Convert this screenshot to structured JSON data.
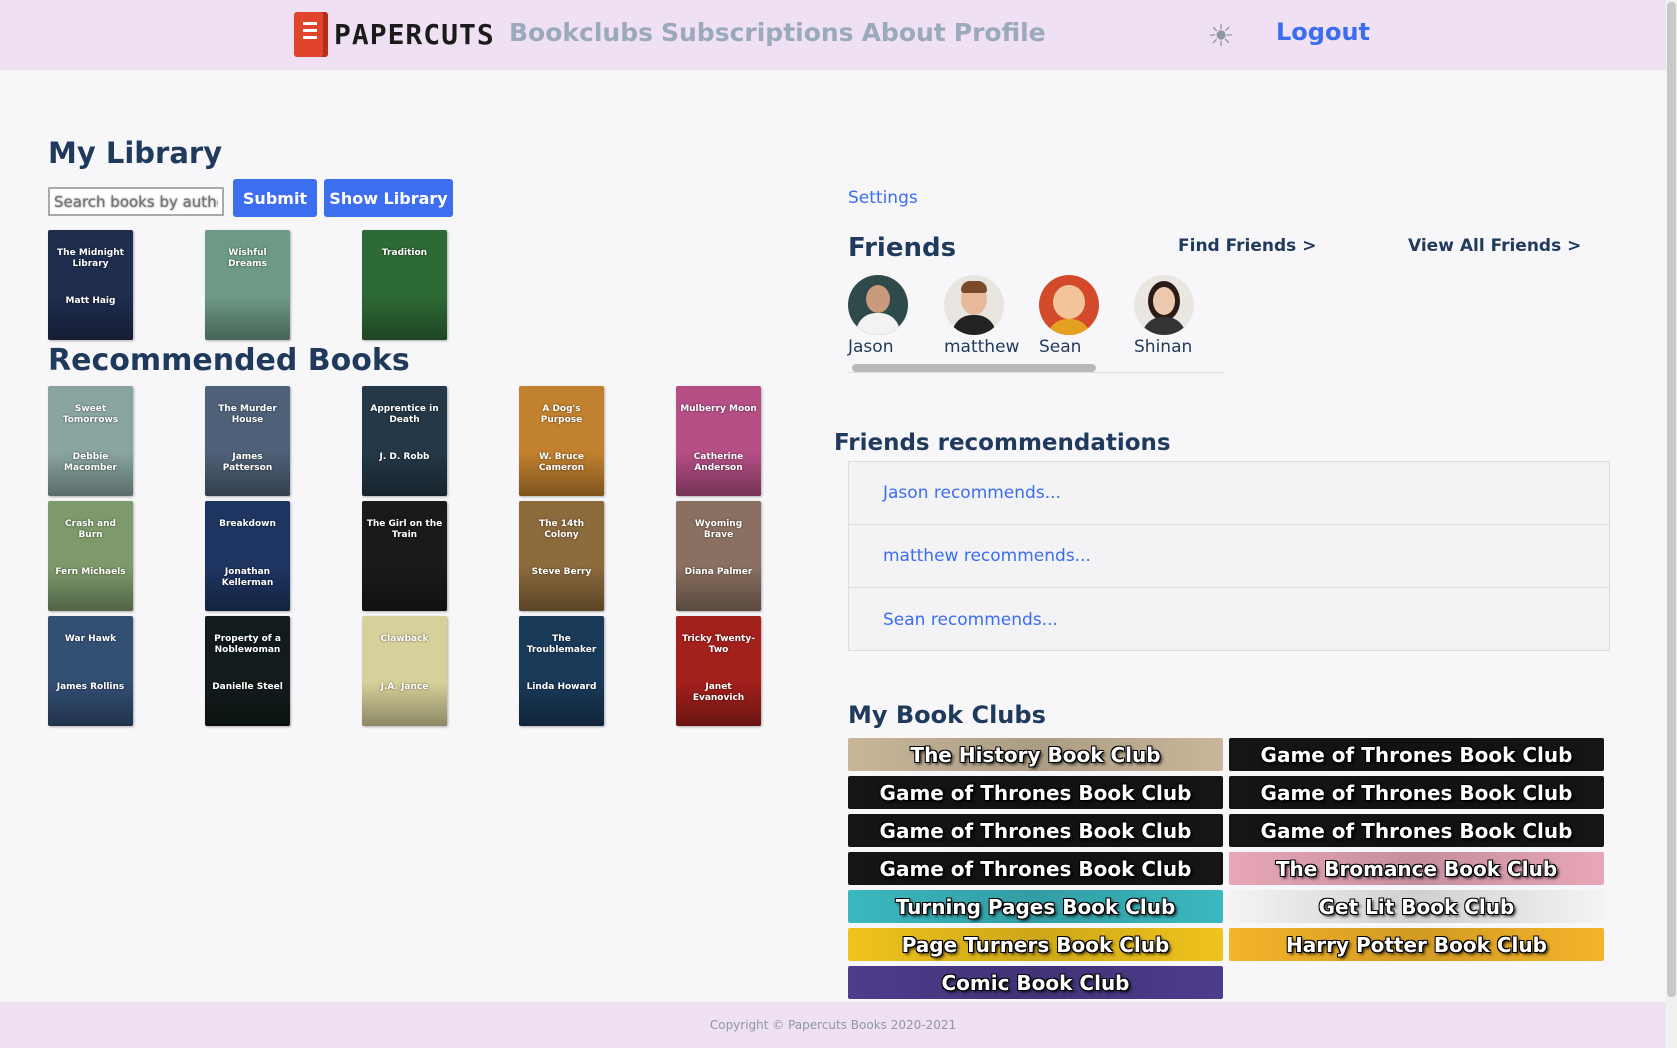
{
  "nav": {
    "logo_text": "PAPERCUTS",
    "links": [
      "Bookclubs",
      "Subscriptions",
      "About",
      "Profile"
    ],
    "theme_icon": "sun-icon",
    "logout": "Logout"
  },
  "library": {
    "heading": "My Library",
    "search_placeholder": "Search books by author",
    "submit_label": "Submit",
    "show_library_label": "Show Library",
    "books": [
      {
        "title": "The Midnight Library",
        "author": "Matt Haig",
        "color": "#1f2d4f"
      },
      {
        "title": "Wishful Dreams",
        "author": "",
        "color": "#6d9a86"
      },
      {
        "title": "Tradition",
        "author": "",
        "color": "#2e6a35"
      }
    ]
  },
  "recommended": {
    "heading": "Recommended Books",
    "books": [
      {
        "title": "Sweet Tomorrows",
        "author": "Debbie Macomber",
        "color": "#8aa5a0"
      },
      {
        "title": "The Murder House",
        "author": "James Patterson",
        "color": "#4f6178"
      },
      {
        "title": "Apprentice in Death",
        "author": "J. D. Robb",
        "color": "#243847"
      },
      {
        "title": "A Dog's Purpose",
        "author": "W. Bruce Cameron",
        "color": "#c2812f"
      },
      {
        "title": "Mulberry Moon",
        "author": "Catherine Anderson",
        "color": "#b54f86"
      },
      {
        "title": "Crash and Burn",
        "author": "Fern Michaels",
        "color": "#7e9a6b"
      },
      {
        "title": "Breakdown",
        "author": "Jonathan Kellerman",
        "color": "#1e3561"
      },
      {
        "title": "The Girl on the Train",
        "author": "",
        "color": "#1a1a1a"
      },
      {
        "title": "The 14th Colony",
        "author": "Steve Berry",
        "color": "#8b6a3c"
      },
      {
        "title": "Wyoming Brave",
        "author": "Diana Palmer",
        "color": "#8a7060"
      },
      {
        "title": "War Hawk",
        "author": "James Rollins",
        "color": "#334f74"
      },
      {
        "title": "Property of a Noblewoman",
        "author": "Danielle Steel",
        "color": "#121c1c"
      },
      {
        "title": "Clawback",
        "author": "J.A. Jance",
        "color": "#d6d09a"
      },
      {
        "title": "The Troublemaker",
        "author": "Linda Howard",
        "color": "#193a58"
      },
      {
        "title": "Tricky Twenty-Two",
        "author": "Janet Evanovich",
        "color": "#a3201c"
      }
    ]
  },
  "side": {
    "settings": "Settings",
    "friends_heading": "Friends",
    "find_friends": "Find Friends >",
    "view_all_friends": "View All Friends >",
    "friends": [
      {
        "name": "Jason",
        "color": "#2f4a4a"
      },
      {
        "name": "matthew",
        "color": "#d8c8b8"
      },
      {
        "name": "Sean",
        "color": "#d34a2a"
      },
      {
        "name": "Shinan",
        "color": "#e0d8d0"
      }
    ],
    "recs_heading": "Friends recommendations",
    "recs": [
      "Jason recommends...",
      "matthew recommends...",
      "Sean recommends..."
    ],
    "clubs_heading": "My Book Clubs",
    "clubs": [
      {
        "name": "The History Book Club",
        "color": "#c9b79a"
      },
      {
        "name": "Game of Thrones Book Club",
        "color": "#151515"
      },
      {
        "name": "Game of Thrones Book Club",
        "color": "#151515"
      },
      {
        "name": "Game of Thrones Book Club",
        "color": "#151515"
      },
      {
        "name": "Game of Thrones Book Club",
        "color": "#151515"
      },
      {
        "name": "Game of Thrones Book Club",
        "color": "#151515"
      },
      {
        "name": "Game of Thrones Book Club",
        "color": "#151515"
      },
      {
        "name": "The Bromance Book Club",
        "color": "#e8a7b8"
      },
      {
        "name": "Turning Pages Book Club",
        "color": "#3bb8c0"
      },
      {
        "name": "Get Lit Book Club",
        "color": "#f4f4f4"
      },
      {
        "name": "Page Turners Book Club",
        "color": "#f0c41d"
      },
      {
        "name": "Harry Potter Book Club",
        "color": "#f5b52a"
      },
      {
        "name": "Comic Book Club",
        "color": "#4d3c8c"
      }
    ]
  },
  "footer": "Copyright © Papercuts Books 2020-2021"
}
